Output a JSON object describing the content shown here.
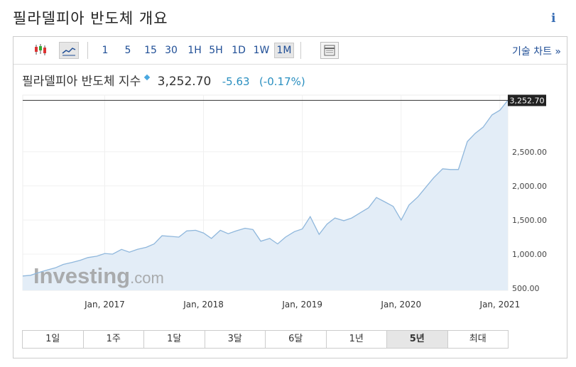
{
  "page": {
    "title": "필라델피아 반도체 개요",
    "info_label": "i"
  },
  "toolbar": {
    "intervals": [
      "1",
      "5",
      "15",
      "30",
      "1H",
      "5H",
      "1D",
      "1W",
      "1M"
    ],
    "active_interval": "1M",
    "tech_chart_link": "기술 차트 »"
  },
  "quote": {
    "name": "필라델피아 반도체 지수",
    "price": "3,252.70",
    "change": "-5.63",
    "change_pct": "(-0.17%)"
  },
  "watermark": "Investing.com",
  "periods": [
    "1일",
    "1주",
    "1달",
    "3달",
    "6달",
    "1년",
    "5년",
    "최대"
  ],
  "active_period": "5년",
  "colors": {
    "line": "#8fb7dc",
    "area": "#e3edf7",
    "link": "#1f4e96",
    "change": "#2a8fc0"
  },
  "chart_data": {
    "type": "area",
    "ylim": [
      470,
      3330
    ],
    "yticks": [
      500,
      1000,
      1500,
      2000,
      2500
    ],
    "ytick_labels": [
      "500.00",
      "1,000.00",
      "1,500.00",
      "2,000.00",
      "2,500.00"
    ],
    "xticks": [
      2017.0,
      2018.0,
      2019.0,
      2020.0,
      2021.0
    ],
    "xtick_labels": [
      "Jan, 2017",
      "Jan, 2018",
      "Jan, 2019",
      "Jan, 2020",
      "Jan, 2021"
    ],
    "xlim": [
      2016.17,
      2021.08
    ],
    "last_value": 3252.7,
    "last_label": "3,252.70",
    "x": [
      2016.17,
      2016.25,
      2016.33,
      2016.42,
      2016.5,
      2016.58,
      2016.67,
      2016.75,
      2016.83,
      2016.92,
      2017.0,
      2017.08,
      2017.17,
      2017.25,
      2017.33,
      2017.42,
      2017.5,
      2017.58,
      2017.67,
      2017.75,
      2017.83,
      2017.92,
      2018.0,
      2018.08,
      2018.17,
      2018.25,
      2018.33,
      2018.42,
      2018.5,
      2018.58,
      2018.67,
      2018.75,
      2018.83,
      2018.92,
      2019.0,
      2019.08,
      2019.17,
      2019.25,
      2019.33,
      2019.42,
      2019.5,
      2019.58,
      2019.67,
      2019.75,
      2019.83,
      2019.92,
      2020.0,
      2020.08,
      2020.17,
      2020.25,
      2020.33,
      2020.42,
      2020.5,
      2020.58,
      2020.67,
      2020.75,
      2020.83,
      2020.92,
      2021.0,
      2021.08
    ],
    "y": [
      680,
      690,
      730,
      770,
      800,
      850,
      880,
      910,
      950,
      970,
      1010,
      1000,
      1070,
      1030,
      1070,
      1100,
      1150,
      1270,
      1260,
      1250,
      1340,
      1350,
      1310,
      1230,
      1350,
      1300,
      1340,
      1380,
      1360,
      1190,
      1230,
      1150,
      1250,
      1330,
      1370,
      1550,
      1290,
      1440,
      1530,
      1490,
      1530,
      1600,
      1680,
      1830,
      1770,
      1700,
      1500,
      1720,
      1840,
      1980,
      2120,
      2250,
      2240,
      2240,
      2650,
      2770,
      2860,
      3040,
      3110,
      3252.7
    ]
  }
}
